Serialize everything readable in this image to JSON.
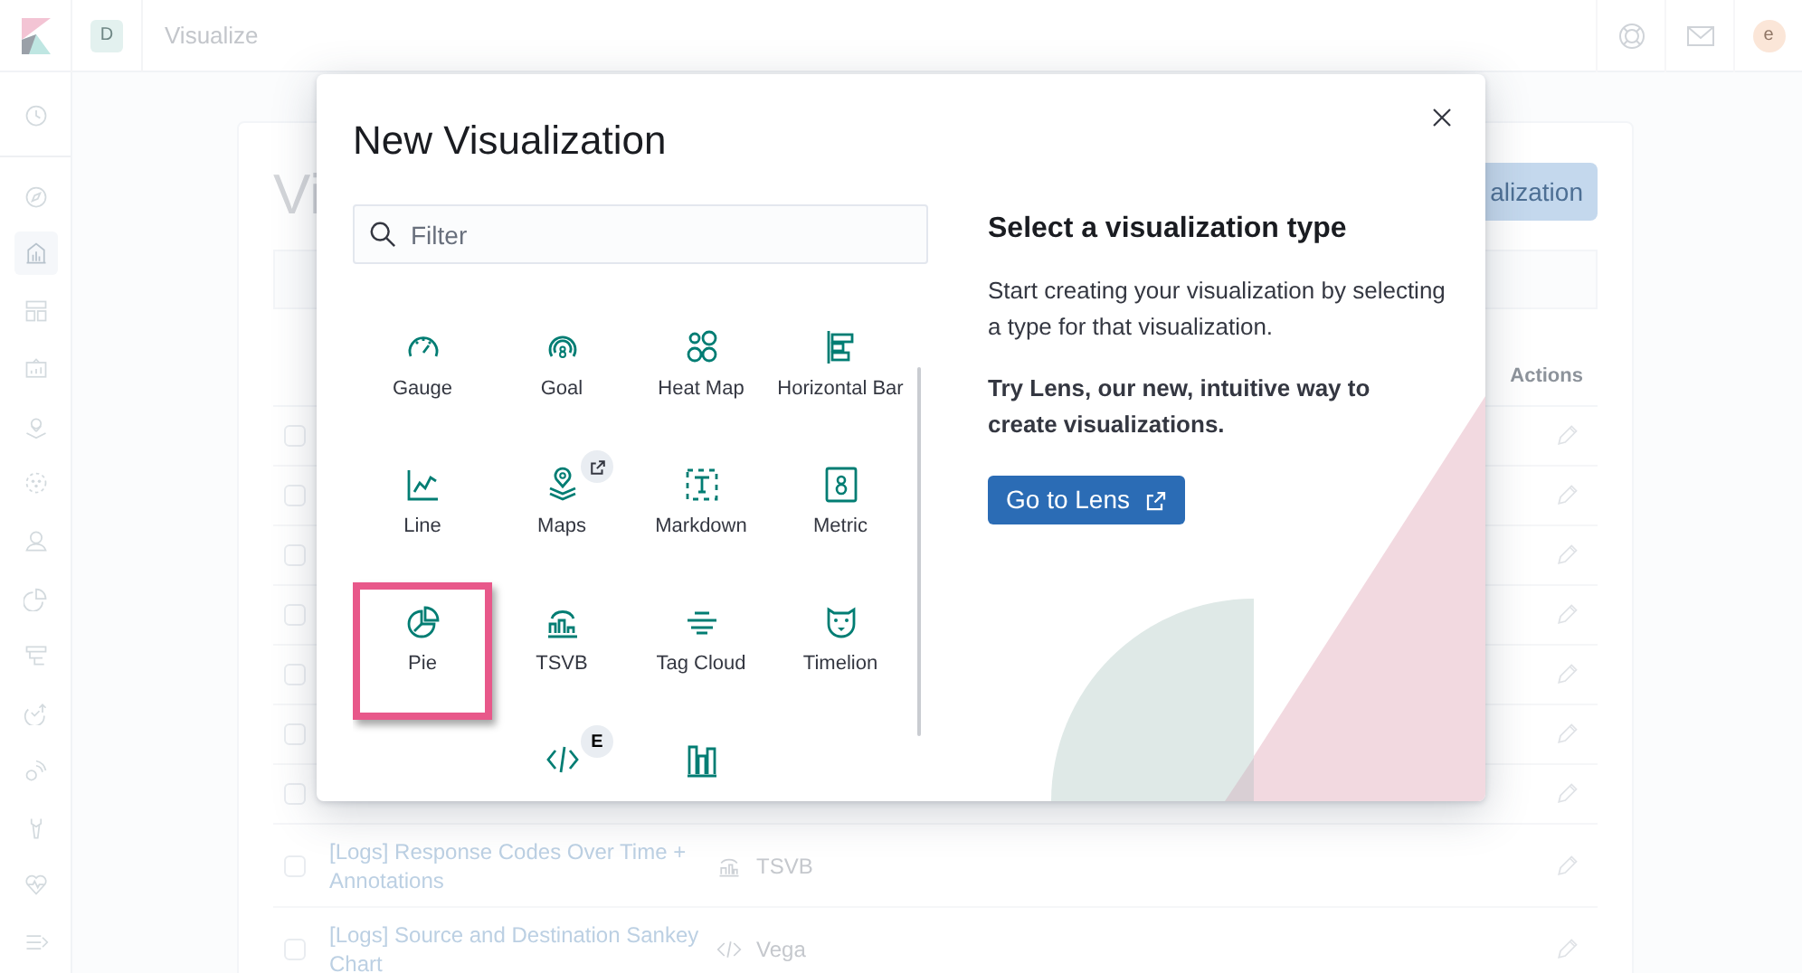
{
  "header": {
    "space_initial": "D",
    "title": "Visualize",
    "user_initial": "e"
  },
  "sidebar": {
    "items": [
      {
        "selected": false
      },
      {
        "selected": false
      },
      {
        "selected": true
      },
      {
        "selected": false
      },
      {
        "selected": false
      },
      {
        "selected": false
      },
      {
        "selected": false
      },
      {
        "selected": false
      },
      {
        "selected": false
      },
      {
        "selected": false
      },
      {
        "selected": false
      },
      {
        "selected": false
      },
      {
        "selected": false
      },
      {
        "selected": false
      },
      {
        "selected": false
      }
    ]
  },
  "page": {
    "title": "Vi",
    "create_button": "alization",
    "table": {
      "actions_header": "Actions",
      "rows": [
        {
          "checked": false
        },
        {
          "checked": false
        },
        {
          "checked": false
        },
        {
          "checked": false
        },
        {
          "checked": false
        },
        {
          "checked": false
        },
        {
          "checked": false
        },
        {
          "checked": false,
          "title": "[Logs] Response Codes Over Time + Annotations",
          "type": "TSVB"
        },
        {
          "checked": false,
          "title": "[Logs] Source and Destination Sankey Chart",
          "type": "Vega"
        }
      ]
    }
  },
  "modal": {
    "title": "New Visualization",
    "filter_placeholder": "Filter",
    "types": [
      {
        "label": "Gauge",
        "selected": false
      },
      {
        "label": "Goal",
        "selected": false
      },
      {
        "label": "Heat Map",
        "selected": false
      },
      {
        "label": "Horizontal Bar",
        "selected": false
      },
      {
        "label": "Line",
        "selected": false
      },
      {
        "label": "Maps",
        "selected": false,
        "external_link": true
      },
      {
        "label": "Markdown",
        "selected": false
      },
      {
        "label": "Metric",
        "selected": false
      },
      {
        "label": "Pie",
        "selected": true
      },
      {
        "label": "TSVB",
        "selected": false
      },
      {
        "label": "Tag Cloud",
        "selected": false
      },
      {
        "label": "Timelion",
        "selected": false
      },
      {
        "selected": false,
        "badge": "E"
      },
      {
        "selected": false
      }
    ],
    "intro": {
      "title": "Select a visualization type",
      "text": "Start creating your visualization by selecting a type for that visualization.",
      "lens_text": "Try Lens, our new, intuitive way to create visualizations.",
      "lens_button": "Go to Lens"
    }
  }
}
